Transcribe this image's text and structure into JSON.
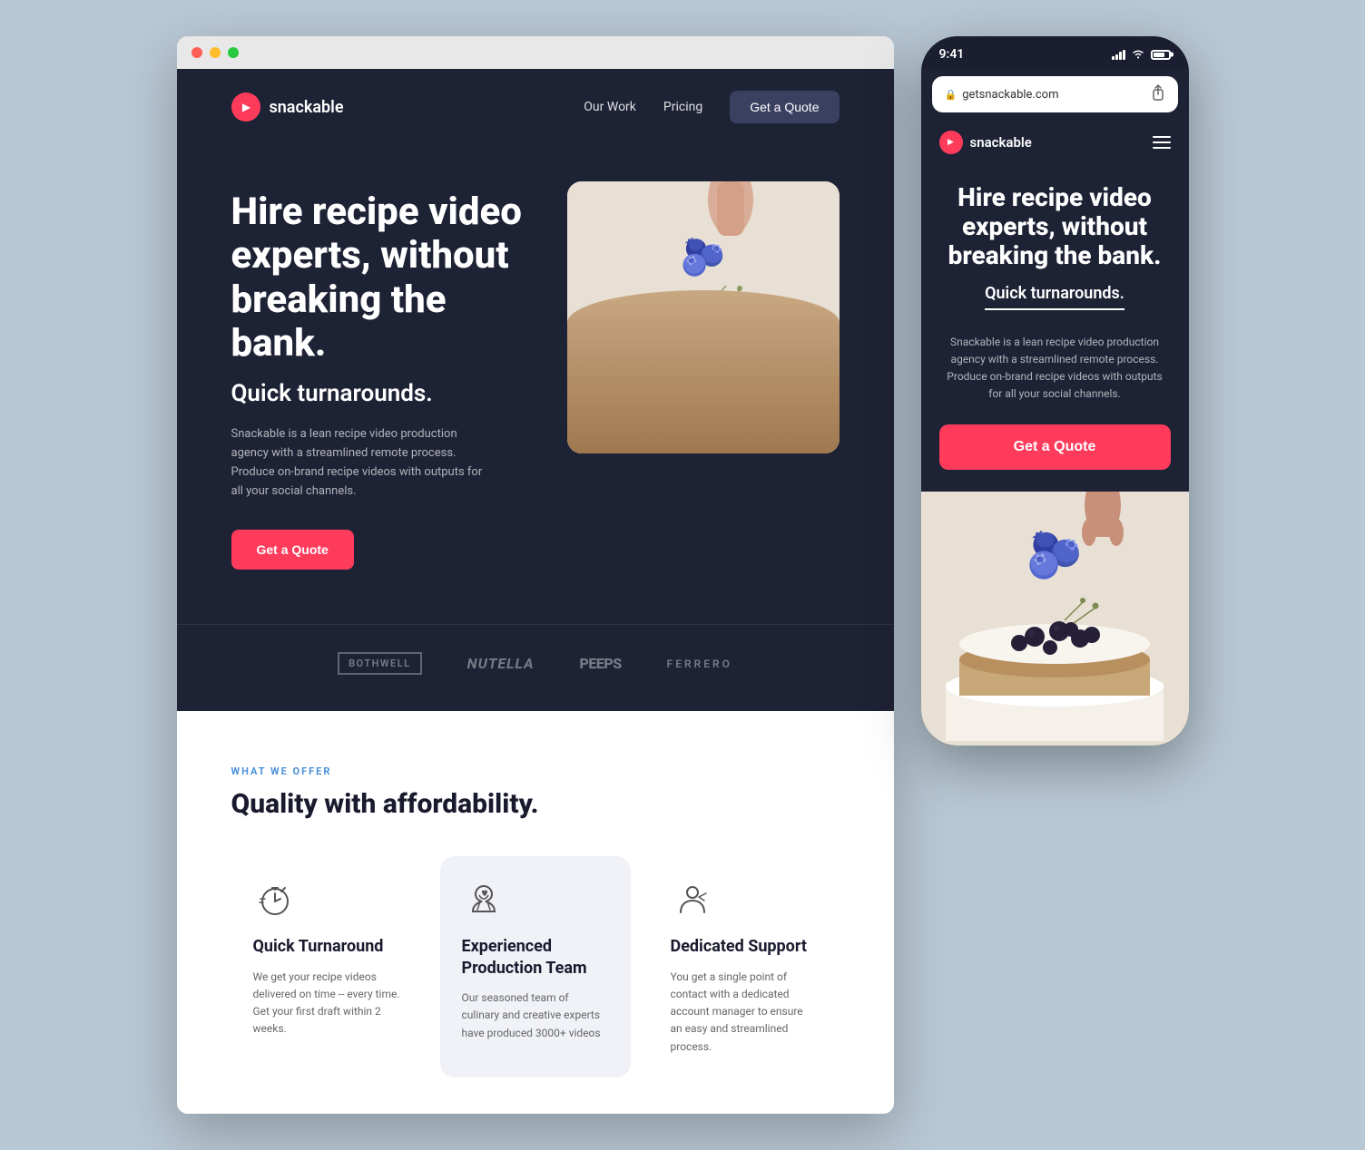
{
  "browser": {
    "dots": [
      "red",
      "yellow",
      "green"
    ]
  },
  "nav": {
    "logo_text": "snackable",
    "link_work": "Our Work",
    "link_pricing": "Pricing",
    "cta_label": "Get a Quote"
  },
  "hero": {
    "title": "Hire recipe video experts, without breaking the bank.",
    "subtitle": "Quick turnarounds.",
    "description": "Snackable is a lean recipe video production agency with a streamlined remote process. Produce on-brand recipe videos with outputs for all your social channels.",
    "cta_label": "Get a Quote"
  },
  "brands": [
    {
      "name": "BOTHWELL",
      "style": "bordered"
    },
    {
      "name": "nutella",
      "style": "italic"
    },
    {
      "name": "Peeps",
      "style": "bold"
    },
    {
      "name": "FERRERO",
      "style": "spaced"
    }
  ],
  "services": {
    "section_label": "WHAT WE OFFER",
    "section_title": "Quality with affordability.",
    "cards": [
      {
        "icon": "⏱",
        "title": "Quick Turnaround",
        "description": "We get your recipe videos delivered on time -- every time. Get your first draft within 2 weeks."
      },
      {
        "icon": "👨‍🍳",
        "title": "Experienced Production Team",
        "description": "Our seasoned team of culinary and creative experts have produced 3000+ videos"
      },
      {
        "icon": "🤝",
        "title": "Dedicated Support",
        "description": "You get a single point of contact with a dedicated account manager to ensure an easy and streamlined process."
      }
    ]
  },
  "mobile": {
    "time": "9:41",
    "url": "getsnackable.com",
    "logo_text": "snackable",
    "hero_title": "Hire recipe video experts, without breaking the bank.",
    "hero_subtitle": "Quick turnarounds.",
    "hero_description": "Snackable is a lean recipe video production agency with a streamlined remote process. Produce on-brand recipe videos with outputs for all your social channels.",
    "cta_label": "Get a Quote"
  }
}
